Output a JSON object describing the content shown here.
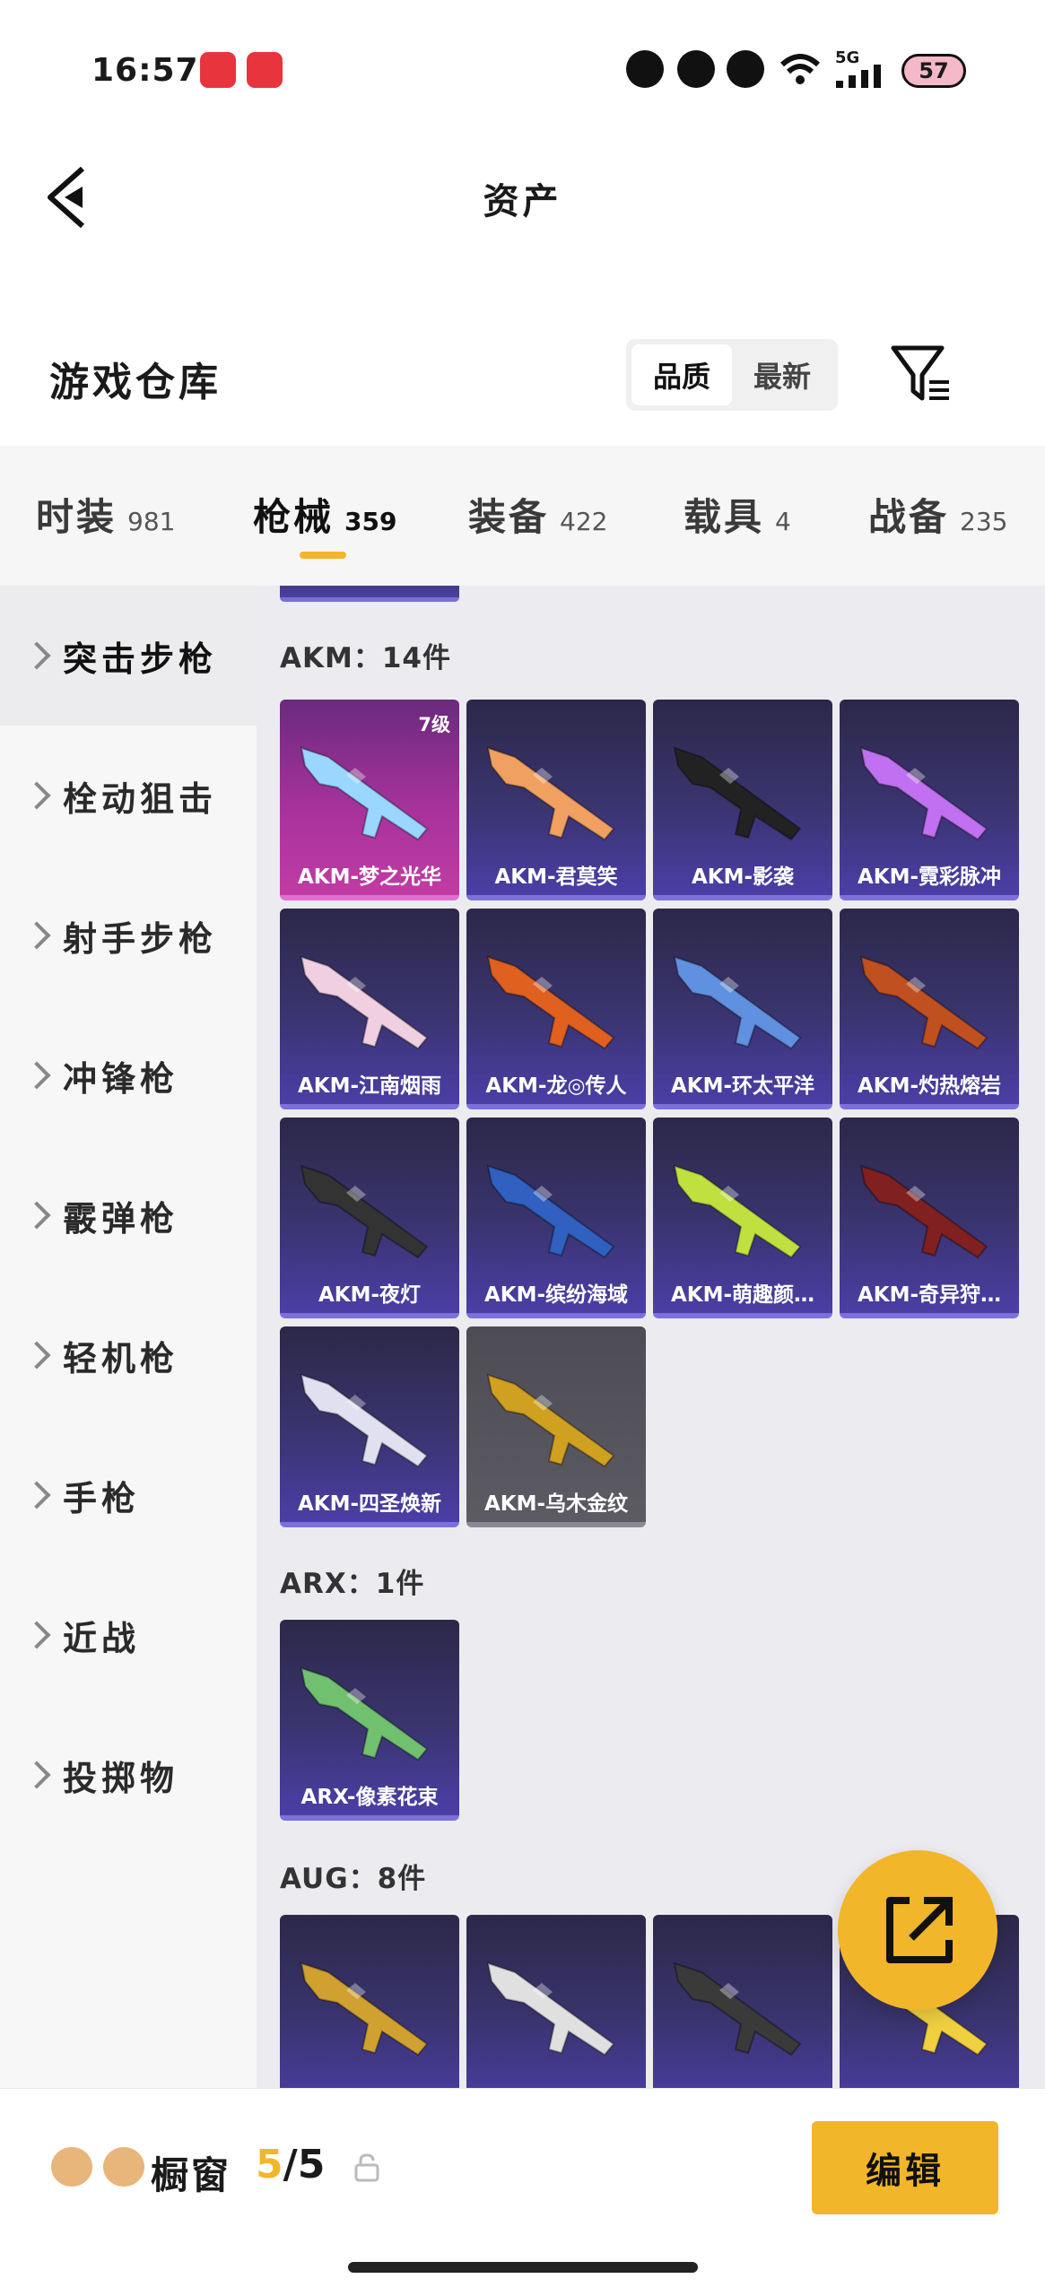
{
  "status_bar": {
    "time": "16:57",
    "network": "5G",
    "battery": "57",
    "icons": [
      "app-icon-video",
      "app-icon-heart",
      "status-icon-1",
      "status-icon-2",
      "status-icon-3",
      "wifi-icon",
      "signal-icon",
      "battery-icon"
    ]
  },
  "nav": {
    "back_icon": "chevron-left-icon",
    "title": "资产"
  },
  "warehouse": {
    "title": "游戏仓库",
    "sort": [
      "品质",
      "最新"
    ],
    "sort_active": "品质",
    "filter_icon": "filter-icon"
  },
  "categories": [
    {
      "label": "时装",
      "count": "981"
    },
    {
      "label": "枪械",
      "count": "359"
    },
    {
      "label": "装备",
      "count": "422"
    },
    {
      "label": "载具",
      "count": "4"
    },
    {
      "label": "战备",
      "count": "235"
    }
  ],
  "category_active": "枪械",
  "sidebar": [
    "突击步枪",
    "栓动狙击",
    "射手步枪",
    "冲锋枪",
    "霰弹枪",
    "轻机枪",
    "手枪",
    "近战",
    "投掷物"
  ],
  "sidebar_active": "突击步枪",
  "groups": [
    {
      "title": "AKM：14件",
      "items": [
        {
          "label": "AKM-梦之光华",
          "badge": "7级",
          "style": "pink"
        },
        {
          "label": "AKM-君莫笑"
        },
        {
          "label": "AKM-影袭"
        },
        {
          "label": "AKM-霓彩脉冲"
        },
        {
          "label": "AKM-江南烟雨"
        },
        {
          "label": "AKM-龙◎传人"
        },
        {
          "label": "AKM-环太平洋"
        },
        {
          "label": "AKM-灼热熔岩"
        },
        {
          "label": "AKM-夜灯"
        },
        {
          "label": "AKM-缤纷海域"
        },
        {
          "label": "AKM-萌趣颜…"
        },
        {
          "label": "AKM-奇异狩…"
        },
        {
          "label": "AKM-四圣焕新"
        },
        {
          "label": "AKM-乌木金纹",
          "style": "gray"
        }
      ]
    },
    {
      "title": "ARX：1件",
      "items": [
        {
          "label": "ARX-像素花束"
        }
      ]
    },
    {
      "title": "AUG：8件",
      "items": [
        {
          "label": ""
        },
        {
          "label": ""
        },
        {
          "label": ""
        },
        {
          "label": ""
        }
      ]
    }
  ],
  "share_icon": "share-icon",
  "bottom": {
    "showcase_label": "橱窗",
    "showcase_current": "5",
    "showcase_sep": "/",
    "showcase_total": "5",
    "lock_icon": "lock-icon",
    "edit_label": "编辑"
  },
  "colors": {
    "accent": "#f2b62a",
    "tile_purple": "#3a3470",
    "tile_pink": "#a6329c",
    "tile_gray": "#5c5b64"
  }
}
